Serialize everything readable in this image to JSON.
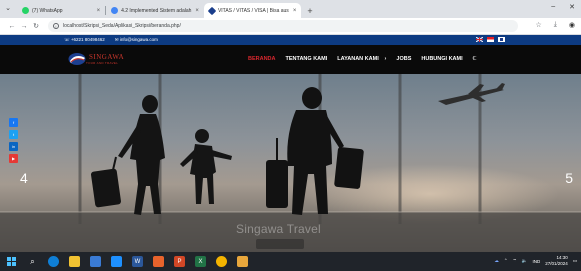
{
  "browser": {
    "tabs": [
      {
        "label": "(7) WhatsApp",
        "favicon_color": "#25d366",
        "active": false
      },
      {
        "label": "4.2 Implemented Sistem adalah",
        "favicon_color": "#4285f4",
        "active": false
      },
      {
        "label": "VITAS / VITAS / VISA | Bisa aus",
        "favicon_color": "#1a3e8c",
        "active": true
      }
    ],
    "newtab_icon": "plus-icon",
    "window_controls": [
      "minimize-icon",
      "close-icon"
    ],
    "address": "localhost/Skripsi_Seda/Aplikasi_Skripsi/beranda.php/",
    "toolbar_icons": [
      "star-icon",
      "download-icon",
      "profile-icon"
    ]
  },
  "site": {
    "topbar": {
      "phone": "☏ +6221 80498462",
      "email": "✉ info@singawa.com",
      "bg_color": "#0d3b82"
    },
    "logo": {
      "name": "SINGAWA",
      "tagline": "TOUR AND TRAVEL",
      "color": "#c9362c"
    },
    "nav": [
      {
        "label": "BERANDA",
        "active": true
      },
      {
        "label": "TENTANG KAMI",
        "active": false
      },
      {
        "label": "LAYANAN KAMI ⠀›",
        "active": false
      },
      {
        "label": "JOBS",
        "active": false
      },
      {
        "label": "HUBUNGI KAMI",
        "active": false
      },
      {
        "label": "ℂ",
        "active": false
      }
    ],
    "nav_active_color": "#d9272e",
    "hero": {
      "slide_left": "4",
      "slide_right": "5",
      "caption": "Singawa Travel",
      "social": [
        {
          "icon": "facebook-icon",
          "color": "#1877f2"
        },
        {
          "icon": "twitter-icon",
          "color": "#1da1f2"
        },
        {
          "icon": "linkedin-icon",
          "color": "#0a66c2"
        },
        {
          "icon": "youtube-icon",
          "color": "#e53935"
        }
      ]
    }
  },
  "taskbar": {
    "time": "14:30",
    "date": "27/01/2024",
    "lang": "IND",
    "icons": [
      "windows-start-icon",
      "search-icon",
      "edge-icon",
      "file-explorer-icon",
      "store-icon",
      "mail-icon",
      "word-icon",
      "app-icon",
      "powerpoint-icon",
      "excel-icon",
      "chrome-icon",
      "folder-icon"
    ]
  }
}
